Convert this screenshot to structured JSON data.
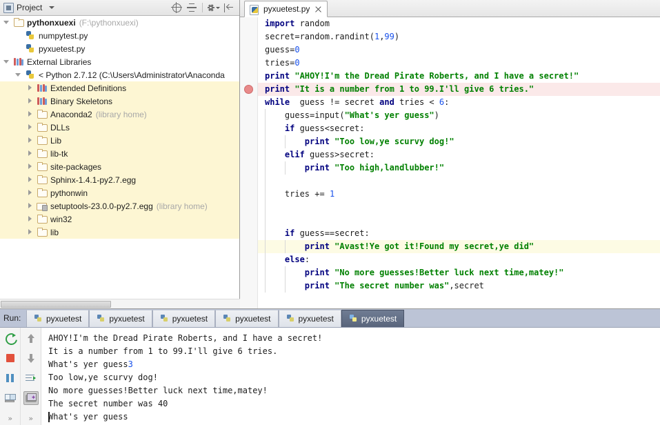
{
  "project_panel": {
    "title": "Project",
    "title_icon": "project-view-icon",
    "toolbar": [
      {
        "name": "locate-file-icon",
        "label": "Select Opened File"
      },
      {
        "name": "collapse-all-icon",
        "label": "Collapse All"
      },
      {
        "name": "settings-gear-icon",
        "label": "Settings"
      },
      {
        "name": "hide-panel-icon",
        "label": "Hide"
      }
    ],
    "tree": [
      {
        "indent": 0,
        "twisty": "open",
        "icon": "folder-icon",
        "label": "pythonxuexi",
        "bold": true,
        "dim": "(F:\\pythonxuexi)",
        "hl": false
      },
      {
        "indent": 1,
        "twisty": "none",
        "icon": "python-file-icon",
        "label": "numpytest.py",
        "bold": false,
        "dim": "",
        "hl": false
      },
      {
        "indent": 1,
        "twisty": "none",
        "icon": "python-file-icon",
        "label": "pyxuetest.py",
        "bold": false,
        "dim": "",
        "hl": false
      },
      {
        "indent": 0,
        "twisty": "open",
        "icon": "library-books-icon",
        "label": "External Libraries",
        "bold": false,
        "dim": "",
        "hl": false
      },
      {
        "indent": 1,
        "twisty": "open",
        "icon": "python-sdk-icon",
        "label": "< Python 2.7.12 (C:\\Users\\Administrator\\Anaconda",
        "bold": false,
        "dim": "",
        "hl": false
      },
      {
        "indent": 2,
        "twisty": "closed",
        "icon": "library-books-icon",
        "label": "Extended Definitions",
        "bold": false,
        "dim": "",
        "hl": true
      },
      {
        "indent": 2,
        "twisty": "closed",
        "icon": "library-books-icon",
        "label": "Binary Skeletons",
        "bold": false,
        "dim": "",
        "hl": true
      },
      {
        "indent": 2,
        "twisty": "closed",
        "icon": "folder-icon",
        "label": "Anaconda2",
        "bold": false,
        "dim": "(library home)",
        "hl": true
      },
      {
        "indent": 2,
        "twisty": "closed",
        "icon": "folder-icon",
        "label": "DLLs",
        "bold": false,
        "dim": "",
        "hl": true
      },
      {
        "indent": 2,
        "twisty": "closed",
        "icon": "folder-icon",
        "label": "Lib",
        "bold": false,
        "dim": "",
        "hl": true
      },
      {
        "indent": 2,
        "twisty": "closed",
        "icon": "folder-icon",
        "label": "lib-tk",
        "bold": false,
        "dim": "",
        "hl": true
      },
      {
        "indent": 2,
        "twisty": "closed",
        "icon": "folder-icon",
        "label": "site-packages",
        "bold": false,
        "dim": "",
        "hl": true
      },
      {
        "indent": 2,
        "twisty": "closed",
        "icon": "folder-icon",
        "label": "Sphinx-1.4.1-py2.7.egg",
        "bold": false,
        "dim": "",
        "hl": true
      },
      {
        "indent": 2,
        "twisty": "closed",
        "icon": "folder-icon",
        "label": "pythonwin",
        "bold": false,
        "dim": "",
        "hl": true
      },
      {
        "indent": 2,
        "twisty": "closed",
        "icon": "folder-lock-icon",
        "label": "setuptools-23.0.0-py2.7.egg",
        "bold": false,
        "dim": "(library home)",
        "hl": true
      },
      {
        "indent": 2,
        "twisty": "closed",
        "icon": "folder-icon",
        "label": "win32",
        "bold": false,
        "dim": "",
        "hl": true
      },
      {
        "indent": 2,
        "twisty": "closed",
        "icon": "folder-icon",
        "label": "lib",
        "bold": false,
        "dim": "",
        "hl": true
      }
    ]
  },
  "editor": {
    "tab": {
      "label": "pyxuetest.py",
      "icon": "python-file-icon",
      "close_icon": "close-icon"
    },
    "breakpoint_line_index": 5,
    "caret_line_index": 17,
    "lines": [
      {
        "indent": 0,
        "tokens": [
          {
            "t": "kw",
            "v": "import"
          },
          {
            "t": "pl",
            "v": " random"
          }
        ]
      },
      {
        "indent": 0,
        "tokens": [
          {
            "t": "pl",
            "v": "secret=random.randint("
          },
          {
            "t": "num",
            "v": "1"
          },
          {
            "t": "pl",
            "v": ","
          },
          {
            "t": "num",
            "v": "99"
          },
          {
            "t": "pl",
            "v": ")"
          }
        ]
      },
      {
        "indent": 0,
        "tokens": [
          {
            "t": "pl",
            "v": "guess="
          },
          {
            "t": "num",
            "v": "0"
          }
        ]
      },
      {
        "indent": 0,
        "tokens": [
          {
            "t": "pl",
            "v": "tries="
          },
          {
            "t": "num",
            "v": "0"
          }
        ]
      },
      {
        "indent": 0,
        "tokens": [
          {
            "t": "kw",
            "v": "print"
          },
          {
            "t": "pl",
            "v": " "
          },
          {
            "t": "str",
            "v": "\"AHOY!I'm the Dread Pirate Roberts, and I have a secret!\""
          }
        ]
      },
      {
        "indent": 0,
        "tokens": [
          {
            "t": "kw",
            "v": "print"
          },
          {
            "t": "pl",
            "v": " "
          },
          {
            "t": "str",
            "v": "\"It is a number from 1 to 99.I'll give 6 tries.\""
          }
        ]
      },
      {
        "indent": 0,
        "tokens": [
          {
            "t": "kw",
            "v": "while"
          },
          {
            "t": "pl",
            "v": "  guess != secret "
          },
          {
            "t": "kw",
            "v": "and"
          },
          {
            "t": "pl",
            "v": " tries < "
          },
          {
            "t": "num",
            "v": "6"
          },
          {
            "t": "pl",
            "v": ":"
          }
        ]
      },
      {
        "indent": 1,
        "tokens": [
          {
            "t": "pl",
            "v": "guess=input("
          },
          {
            "t": "str",
            "v": "\"What's yer guess\""
          },
          {
            "t": "pl",
            "v": ")"
          }
        ]
      },
      {
        "indent": 1,
        "tokens": [
          {
            "t": "kw",
            "v": "if"
          },
          {
            "t": "pl",
            "v": " guess<secret:"
          }
        ]
      },
      {
        "indent": 2,
        "tokens": [
          {
            "t": "kw",
            "v": "print"
          },
          {
            "t": "pl",
            "v": " "
          },
          {
            "t": "str",
            "v": "\"Too low,ye scurvy dog!\""
          }
        ]
      },
      {
        "indent": 1,
        "tokens": [
          {
            "t": "kw",
            "v": "elif"
          },
          {
            "t": "pl",
            "v": " guess>secret:"
          }
        ]
      },
      {
        "indent": 2,
        "tokens": [
          {
            "t": "kw",
            "v": "print"
          },
          {
            "t": "pl",
            "v": " "
          },
          {
            "t": "str",
            "v": "\"Too high,landlubber!\""
          }
        ]
      },
      {
        "indent": 1,
        "tokens": []
      },
      {
        "indent": 1,
        "tokens": [
          {
            "t": "pl",
            "v": "tries += "
          },
          {
            "t": "num",
            "v": "1"
          }
        ]
      },
      {
        "indent": 1,
        "tokens": []
      },
      {
        "indent": 1,
        "tokens": []
      },
      {
        "indent": 1,
        "tokens": [
          {
            "t": "kw",
            "v": "if"
          },
          {
            "t": "pl",
            "v": " guess==secret:"
          }
        ]
      },
      {
        "indent": 2,
        "tokens": [
          {
            "t": "kw",
            "v": "print"
          },
          {
            "t": "pl",
            "v": " "
          },
          {
            "t": "str",
            "v": "\"Avast!Ye got it!Found my secret,ye did\""
          }
        ]
      },
      {
        "indent": 1,
        "tokens": [
          {
            "t": "kw",
            "v": "else"
          },
          {
            "t": "pl",
            "v": ":"
          }
        ]
      },
      {
        "indent": 2,
        "tokens": [
          {
            "t": "kw",
            "v": "print"
          },
          {
            "t": "pl",
            "v": " "
          },
          {
            "t": "str",
            "v": "\"No more guesses!Better luck next time,matey!\""
          }
        ]
      },
      {
        "indent": 2,
        "tokens": [
          {
            "t": "kw",
            "v": "print"
          },
          {
            "t": "pl",
            "v": " "
          },
          {
            "t": "str",
            "v": "\"The secret number was\""
          },
          {
            "t": "pl",
            "v": ",secret"
          }
        ]
      }
    ]
  },
  "run_panel": {
    "label": "Run:",
    "tabs": [
      {
        "label": "pyxuetest",
        "active": false
      },
      {
        "label": "pyxuetest",
        "active": false
      },
      {
        "label": "pyxuetest",
        "active": false
      },
      {
        "label": "pyxuetest",
        "active": false
      },
      {
        "label": "pyxuetest",
        "active": false
      },
      {
        "label": "pyxuetest",
        "active": true
      }
    ],
    "side_buttons_left": [
      {
        "name": "rerun-icon"
      },
      {
        "name": "stop-icon"
      },
      {
        "name": "pause-icon"
      },
      {
        "name": "console-toggle-icon"
      },
      {
        "name": "expand-more-icon",
        "glyph": "»"
      }
    ],
    "side_buttons_right": [
      {
        "name": "scroll-up-icon"
      },
      {
        "name": "scroll-down-icon"
      },
      {
        "name": "soft-wrap-icon"
      },
      {
        "name": "print-icon",
        "selected": true
      },
      {
        "name": "expand-more-icon",
        "glyph": "»"
      }
    ],
    "console_lines": [
      {
        "text": "AHOY!I'm the Dread Pirate Roberts, and I have a secret!",
        "input": ""
      },
      {
        "text": "It is a number from 1 to 99.I'll give 6 tries.",
        "input": ""
      },
      {
        "text": "What's yer guess",
        "input": "3"
      },
      {
        "text": "Too low,ye scurvy dog!",
        "input": ""
      },
      {
        "text": "No more guesses!Better luck next time,matey!",
        "input": ""
      },
      {
        "text": "The secret number was 40",
        "input": ""
      },
      {
        "text": "What's yer guess",
        "input": ""
      }
    ]
  },
  "colors": {
    "keyword": "#00007f",
    "string": "#008000",
    "number": "#1750eb",
    "breakpoint_line": "#fbe9e9",
    "caret_line": "#fdfbe4",
    "tree_highlight": "#fdf6d3",
    "run_tabbar": "#bcc4d6"
  }
}
